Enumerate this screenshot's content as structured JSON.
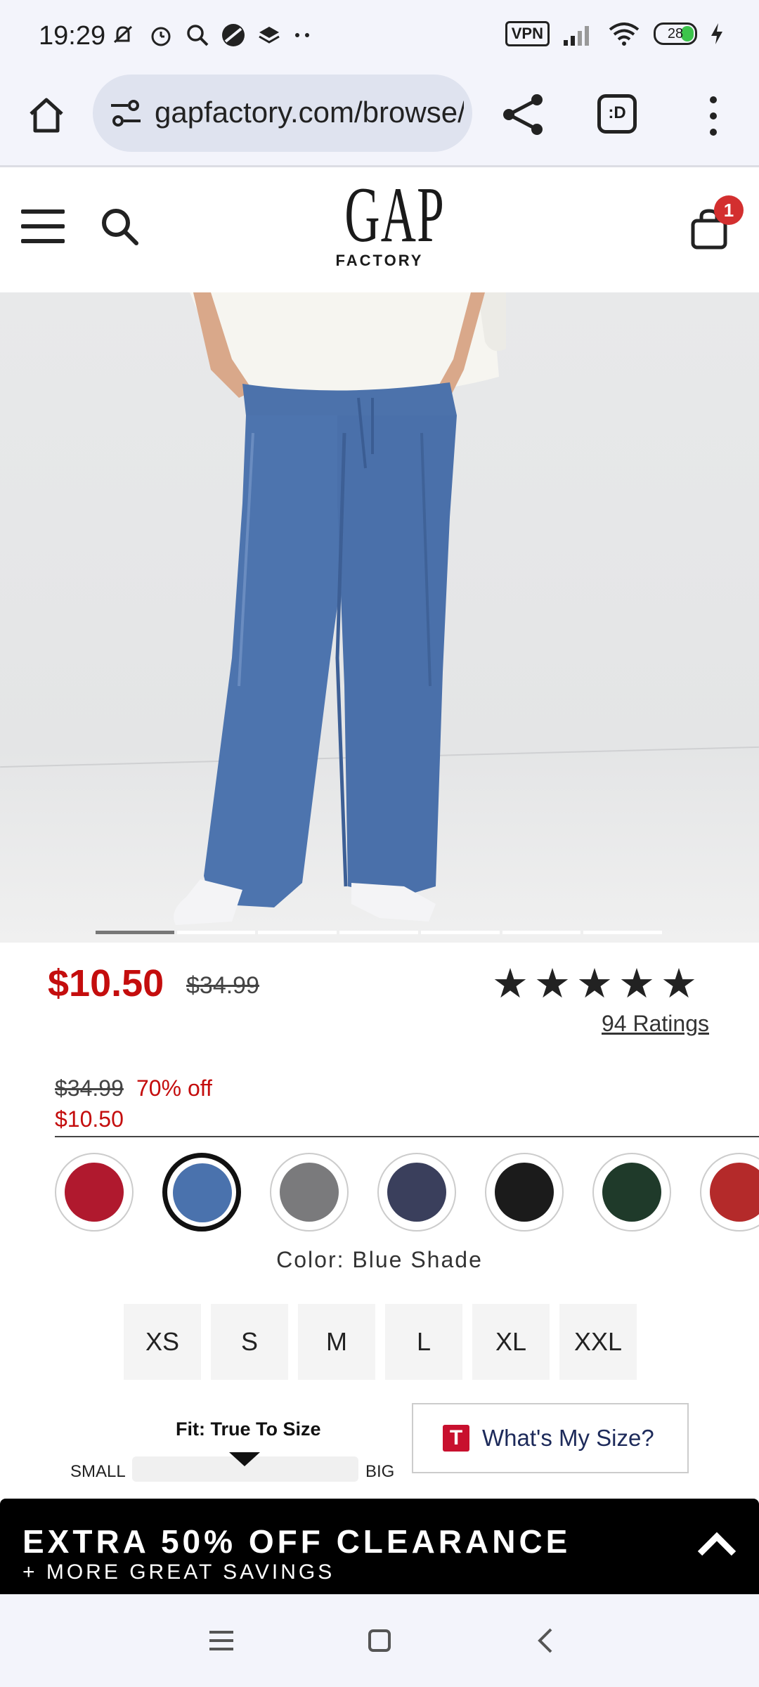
{
  "status_bar": {
    "time": "19:29",
    "vpn": "VPN",
    "battery": "28"
  },
  "browser": {
    "url": "gapfactory.com/browse/product"
  },
  "header": {
    "logo_main": "GAP",
    "logo_sub": "FACTORY",
    "cart_count": "1"
  },
  "product": {
    "price": "$10.50",
    "original_price": "$34.99",
    "rating_stars": 5,
    "stars_text": "★★★★★",
    "ratings_link": "94 Ratings",
    "detail_original": "$34.99",
    "detail_discount": "70% off",
    "detail_sale": "$10.50",
    "image_page_count": 7,
    "image_active_index": 0,
    "color_label": "Color: Blue Shade",
    "swatches": [
      {
        "name": "red-buffalo-check",
        "color": "#b0192e"
      },
      {
        "name": "blue-shade",
        "color": "#4a72ad",
        "selected": true
      },
      {
        "name": "grey-windowpane",
        "color": "#7a7a7c"
      },
      {
        "name": "navy-gingham",
        "color": "#3a3f5c"
      },
      {
        "name": "black",
        "color": "#1b1b1b"
      },
      {
        "name": "green-tartan",
        "color": "#1f3a2a"
      },
      {
        "name": "red-plaid",
        "color": "#b42a2a"
      }
    ],
    "sizes": [
      "XS",
      "S",
      "M",
      "L",
      "XL",
      "XXL"
    ],
    "fit": {
      "title": "Fit: True To Size",
      "small_label": "SMALL",
      "big_label": "BIG"
    },
    "size_help": {
      "icon_letter": "T",
      "label": "What's My Size?"
    }
  },
  "promo": {
    "title": "EXTRA 50% OFF CLEARANCE",
    "subtitle": "+ MORE GREAT SAVINGS"
  },
  "colors": {
    "sale_red": "#c40d0d",
    "badge_red": "#d32f2f"
  }
}
